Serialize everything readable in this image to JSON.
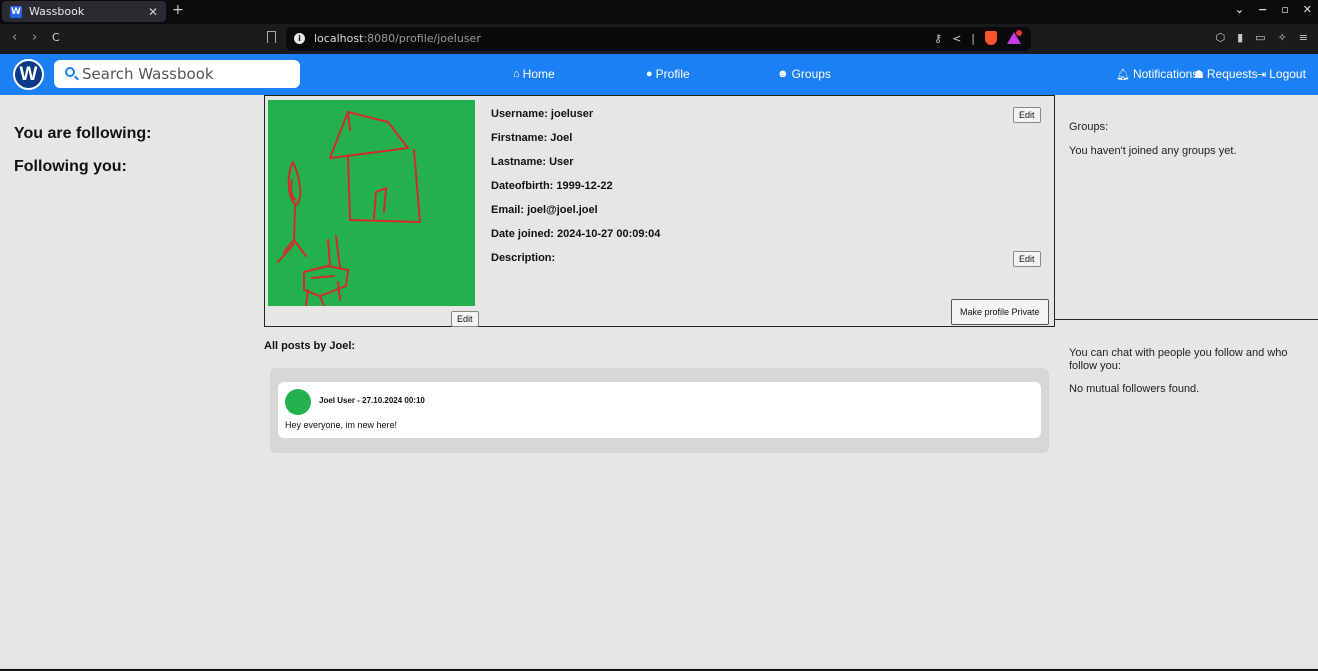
{
  "browser": {
    "tab_title": "Wassbook",
    "tab_close": "✕",
    "new_tab": "+",
    "url_host": "localhost",
    "url_rest": ":8080/profile/joeluser",
    "back": "‹",
    "forward": "›",
    "reload": "C",
    "window_minimize": "−",
    "window_maximize": "▫",
    "window_close": "✕",
    "window_menu": "⌄"
  },
  "navbar": {
    "logo": "W",
    "search_placeholder": "Search Wassbook",
    "home": "Home",
    "profile": "Profile",
    "groups": "Groups",
    "notifications": "Notifications",
    "requests": "Requests",
    "logout": "Logout",
    "color": "#1b7ff5"
  },
  "sidebar": {
    "following_heading": "You are following:",
    "followers_heading": "Following you:"
  },
  "profile": {
    "username": "Username: joeluser",
    "firstname": "Firstname: Joel",
    "lastname": "Lastname: User",
    "dob": "Dateofbirth: 1999-12-22",
    "email": "Email: joel@joel.joel",
    "date_joined": "Date joined: 2024-10-27 00:09:04",
    "description": "Description:",
    "edit_label": "Edit",
    "privacy_button": "Make profile Private",
    "avatar_color": "#22b14c",
    "drawing_color": "#d42a2a"
  },
  "right_panel": {
    "groups_label": "Groups:",
    "groups_empty": "You haven't joined any groups yet.",
    "chat_info": "You can chat with people you follow and who follow you:",
    "chat_empty": "No mutual followers found."
  },
  "posts": {
    "title": "All posts by Joel:",
    "items": [
      {
        "author": "Joel User - 27.10.2024 00:10",
        "text": "Hey everyone, im new here!"
      }
    ]
  }
}
